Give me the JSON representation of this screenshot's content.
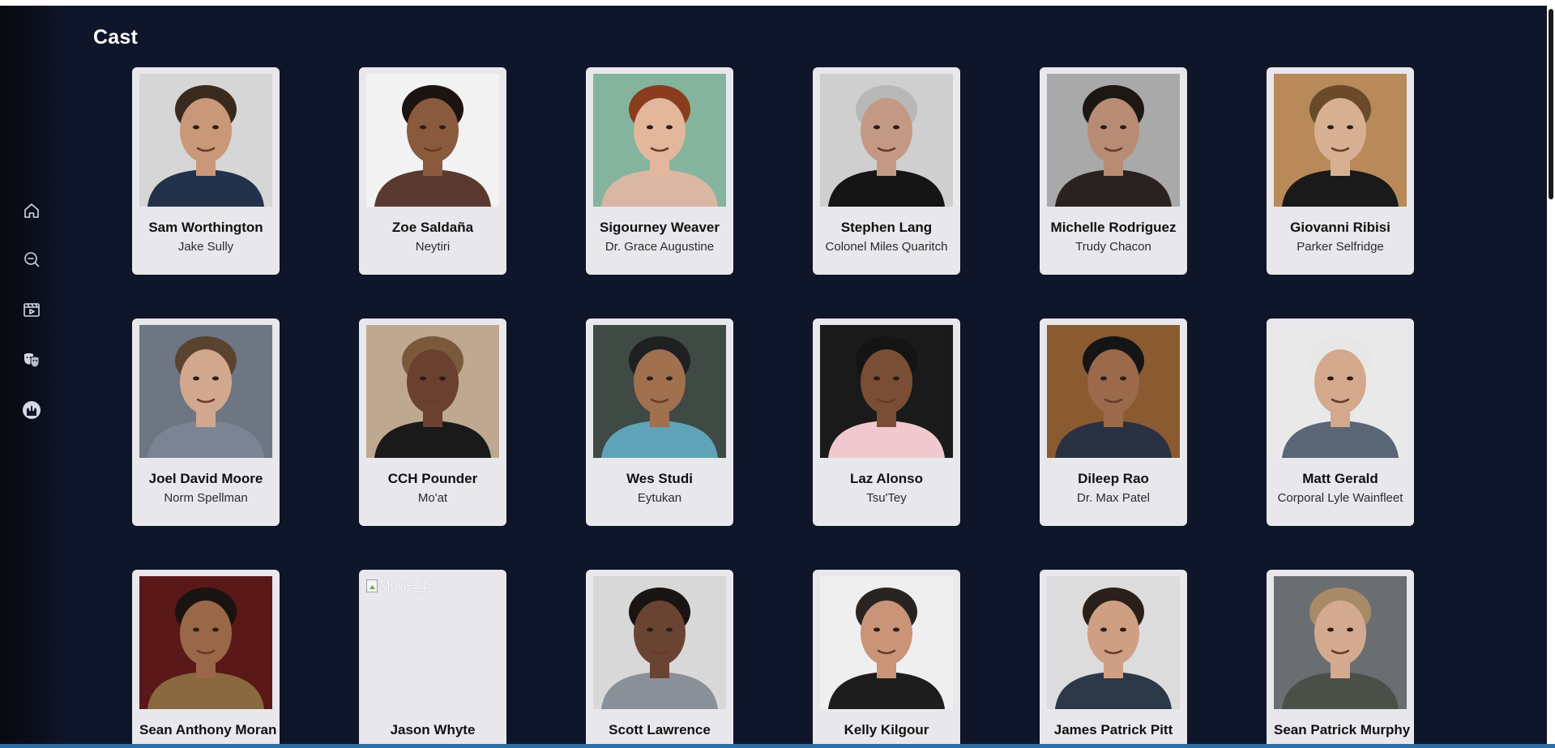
{
  "page": {
    "title": "Cast"
  },
  "sidebar": {
    "items": [
      {
        "icon": "home-icon",
        "label": "Home"
      },
      {
        "icon": "search-icon",
        "label": "Search"
      },
      {
        "icon": "movies-icon",
        "label": "Movies"
      },
      {
        "icon": "theater-masks-icon",
        "label": "Cast"
      },
      {
        "icon": "castle-icon",
        "label": "Disney"
      }
    ]
  },
  "cast": [
    {
      "name": "Sam Worthington",
      "role": "Jake Sully",
      "skin": "#c99878",
      "hair": "#3a2a1e",
      "bg": "#d6d6d6",
      "shirt": "#22324a"
    },
    {
      "name": "Zoe Saldaña",
      "role": "Neytiri",
      "skin": "#8a5a3e",
      "hair": "#1b1411",
      "bg": "#f2f2f2",
      "shirt": "#5a3a30"
    },
    {
      "name": "Sigourney Weaver",
      "role": "Dr. Grace Augustine",
      "skin": "#e2b79c",
      "hair": "#8a3d1e",
      "bg": "#84b49d",
      "shirt": "#d9b7a3"
    },
    {
      "name": "Stephen Lang",
      "role": "Colonel Miles Quaritch",
      "skin": "#c49983",
      "hair": "#b8b8b8",
      "bg": "#cfcfcf",
      "shirt": "#151515"
    },
    {
      "name": "Michelle Rodriguez",
      "role": "Trudy Chacon",
      "skin": "#b88c74",
      "hair": "#1d1714",
      "bg": "#a9a9a9",
      "shirt": "#2a2220"
    },
    {
      "name": "Giovanni Ribisi",
      "role": "Parker Selfridge",
      "skin": "#d7b093",
      "hair": "#6b4a2a",
      "bg": "#b88a5a",
      "shirt": "#1a1a1a"
    },
    {
      "name": "Joel David Moore",
      "role": "Norm Spellman",
      "skin": "#d1a88e",
      "hair": "#5a4430",
      "bg": "#6e7583",
      "shirt": "#7a8494"
    },
    {
      "name": "CCH Pounder",
      "role": "Mo'at",
      "skin": "#6a4030",
      "hair": "#7a5a3a",
      "bg": "#bfa890",
      "shirt": "#1a1a1a"
    },
    {
      "name": "Wes Studi",
      "role": "Eytukan",
      "skin": "#a0704f",
      "hair": "#1e2022",
      "bg": "#3f4a45",
      "shirt": "#5fa3b8"
    },
    {
      "name": "Laz Alonso",
      "role": "Tsu'Tey",
      "skin": "#7a4e34",
      "hair": "#141414",
      "bg": "#1a1a1a",
      "shirt": "#f0c8d0"
    },
    {
      "name": "Dileep Rao",
      "role": "Dr. Max Patel",
      "skin": "#9a6a4a",
      "hair": "#151515",
      "bg": "#8a5a30",
      "shirt": "#2a3142"
    },
    {
      "name": "Matt Gerald",
      "role": "Corporal Lyle Wainfleet",
      "skin": "#d4a88c",
      "hair": "#e7e7e7",
      "bg": "#e9e9e9",
      "shirt": "#5a6676"
    },
    {
      "name": "Sean Anthony Moran",
      "role": "",
      "skin": "#9a6848",
      "hair": "#1a1410",
      "bg": "#5a1818",
      "shirt": "#8a6840"
    },
    {
      "name": "Jason Whyte",
      "role": "",
      "broken": true,
      "alt": "Movie_13"
    },
    {
      "name": "Scott Lawrence",
      "role": "",
      "skin": "#6a4432",
      "hair": "#1a1412",
      "bg": "#d8d8d8",
      "shirt": "#8a9098"
    },
    {
      "name": "Kelly Kilgour",
      "role": "",
      "skin": "#c99478",
      "hair": "#2a2420",
      "bg": "#efefef",
      "shirt": "#1d1d1d"
    },
    {
      "name": "James Patrick Pitt",
      "role": "",
      "skin": "#cf9f84",
      "hair": "#2a2019",
      "bg": "#dcdcdc",
      "shirt": "#2c3748"
    },
    {
      "name": "Sean Patrick Murphy",
      "role": "",
      "skin": "#d3aa8f",
      "hair": "#a88a68",
      "bg": "#6a6e70",
      "shirt": "#4a5048"
    }
  ]
}
